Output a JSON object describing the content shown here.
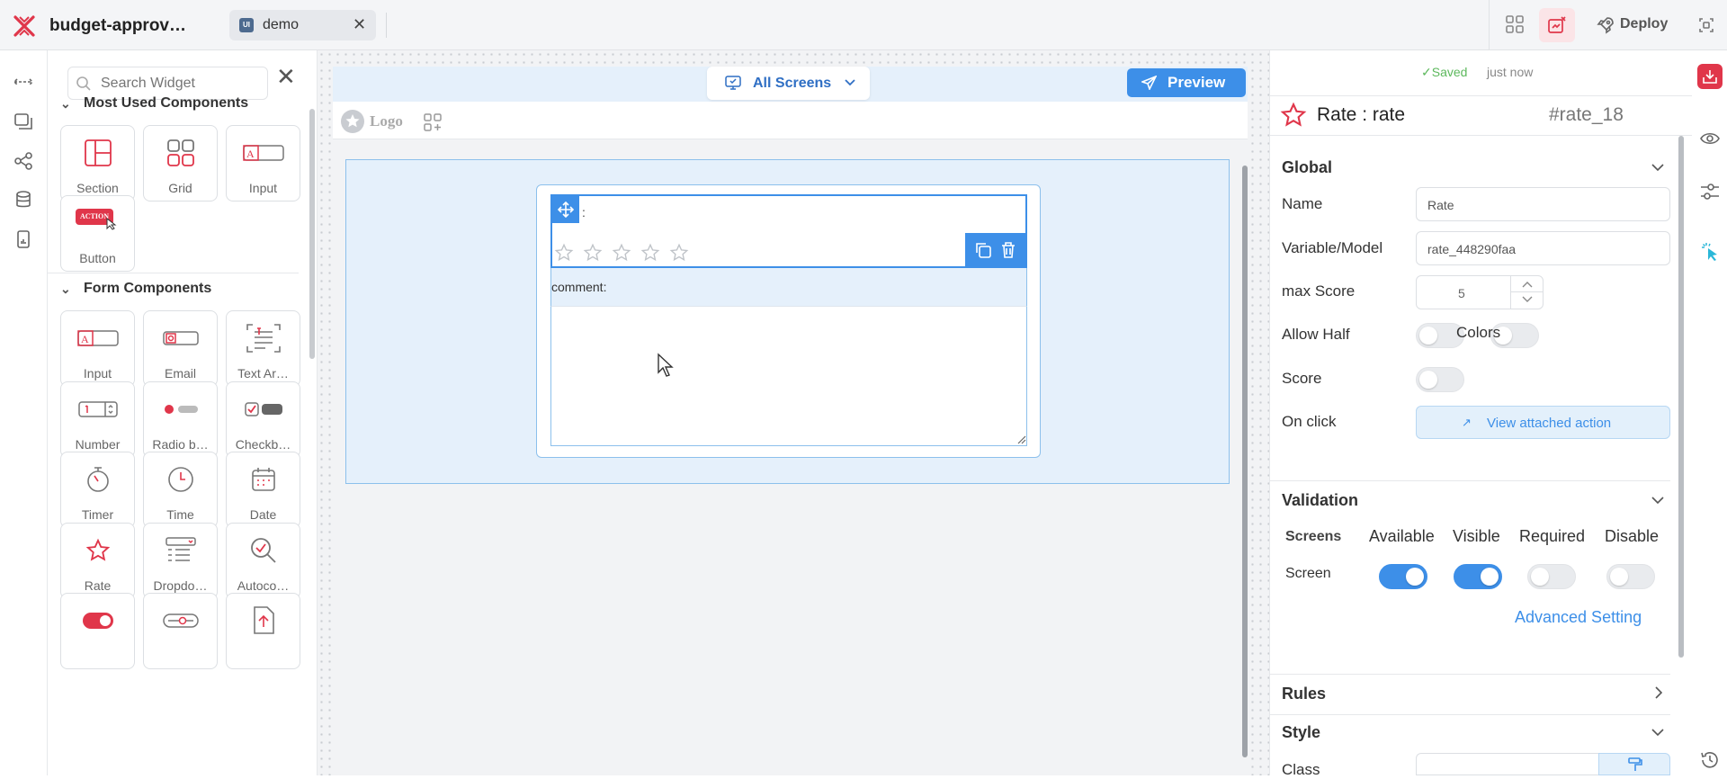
{
  "app": {
    "title": "budget-approv…"
  },
  "tabs": [
    {
      "label": "demo",
      "badge": "UI"
    }
  ],
  "topbar": {
    "deploy_label": "Deploy"
  },
  "widget_panel": {
    "search_placeholder": "Search Widget",
    "sections": [
      {
        "title": "Most Used Components",
        "items": [
          "Section",
          "Grid",
          "Input",
          "Button"
        ]
      },
      {
        "title": "Form Components",
        "items": [
          "Input",
          "Email",
          "Text Ar…",
          "Number",
          "Radio b…",
          "Checkb…",
          "Timer",
          "Time",
          "Date",
          "Rate",
          "Dropdo…",
          "Autoco…",
          "",
          "",
          ""
        ]
      }
    ],
    "button_icon_text": "ACTION"
  },
  "canvas": {
    "screens_label": "All Screens",
    "preview_label": "Preview",
    "logo_text": "Logo",
    "widget_label": ":",
    "comment_label": "comment:",
    "star_count": 5
  },
  "right_panel": {
    "saved_label": "Saved",
    "saved_time": "just now",
    "widget_title": "Rate : rate",
    "widget_id": "#rate_18",
    "global": {
      "title": "Global",
      "name_label": "Name",
      "name_value": "Rate",
      "variable_label": "Variable/Model",
      "variable_value": "rate_448290faa",
      "max_score_label": "max Score",
      "max_score_value": "5",
      "allow_half_label": "Allow Half",
      "colors_label": "Colors",
      "score_label": "Score",
      "on_click_label": "On click",
      "view_action_label": "View attached action"
    },
    "validation": {
      "title": "Validation",
      "headers": [
        "Screens",
        "Available",
        "Visible",
        "Required",
        "Disable"
      ],
      "row_label": "Screen",
      "states": [
        true,
        true,
        false,
        false
      ],
      "advanced_label": "Advanced Setting"
    },
    "rules_title": "Rules",
    "style_title": "Style",
    "class_label": "Class"
  },
  "colors": {
    "accent": "#3d8fe8",
    "brand": "#e0364a"
  }
}
